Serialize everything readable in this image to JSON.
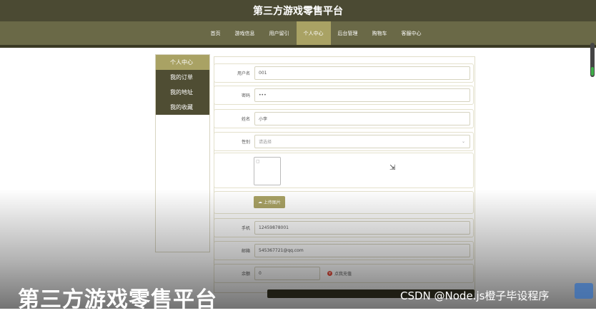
{
  "app": {
    "title": "第三方游戏零售平台"
  },
  "nav": {
    "items": [
      {
        "label": "首页",
        "active": false
      },
      {
        "label": "游戏信息",
        "active": false
      },
      {
        "label": "用户留引",
        "active": false
      },
      {
        "label": "个人中心",
        "active": true
      },
      {
        "label": "后台管理",
        "active": false
      },
      {
        "label": "购物车",
        "active": false
      },
      {
        "label": "客服中心",
        "active": false
      }
    ]
  },
  "sidebar": {
    "items": [
      {
        "label": "个人中心",
        "active": true
      },
      {
        "label": "我的订单",
        "active": false
      },
      {
        "label": "我的地址",
        "active": false
      },
      {
        "label": "我的收藏",
        "active": false
      }
    ]
  },
  "form": {
    "username": {
      "label": "用户名",
      "value": "001"
    },
    "password": {
      "label": "密码",
      "value": "•••"
    },
    "name": {
      "label": "姓名",
      "value": "小李"
    },
    "gender": {
      "label": "性别",
      "placeholder": "请选择"
    },
    "upload_label": "上传图片",
    "phone": {
      "label": "手机",
      "value": "12459878001"
    },
    "email": {
      "label": "邮箱",
      "value": "545367721@qq.com"
    },
    "balance": {
      "label": "余额",
      "value": "0",
      "recharge_label": "点我充值"
    }
  },
  "overlay": {
    "title": "第三方游戏零售平台",
    "watermark": "CSDN @Node.js橙子毕设程序"
  }
}
